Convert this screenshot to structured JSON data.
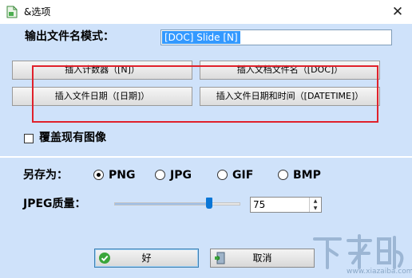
{
  "window": {
    "title": "&选项",
    "close_glyph": "✕",
    "icon": "app-document-icon"
  },
  "output": {
    "label": "输出文件名模式：",
    "value": "[DOC] Slide [N]"
  },
  "insert_buttons": {
    "counter": "插入计数器（[N]）",
    "doc_name": "插入文档文件名（[DOC]）",
    "date": "插入文件日期（[日期]）",
    "datetime": "插入文件日期和时间（[DATETIME]）"
  },
  "overwrite": {
    "label": "覆盖现有图像",
    "checked": false
  },
  "save_as": {
    "label": "另存为：",
    "options": [
      "PNG",
      "JPG",
      "GIF",
      "BMP"
    ],
    "selected": "PNG"
  },
  "jpeg_quality": {
    "label": "JPEG质量：",
    "value": "75",
    "slider_fraction": 0.75,
    "up_glyph": "▲",
    "down_glyph": "▼"
  },
  "actions": {
    "ok_label": "好",
    "cancel_label": "取消",
    "ok_icon": "checkmark-icon",
    "cancel_icon": "cancel-door-icon"
  },
  "watermark": {
    "text": "下载吧",
    "url": "www.xiazaiba.com"
  },
  "colors": {
    "panel": "#cfe2fa",
    "highlight_box": "#e0212b",
    "selection": "#3399ff",
    "slider_thumb": "#0a76d6"
  }
}
